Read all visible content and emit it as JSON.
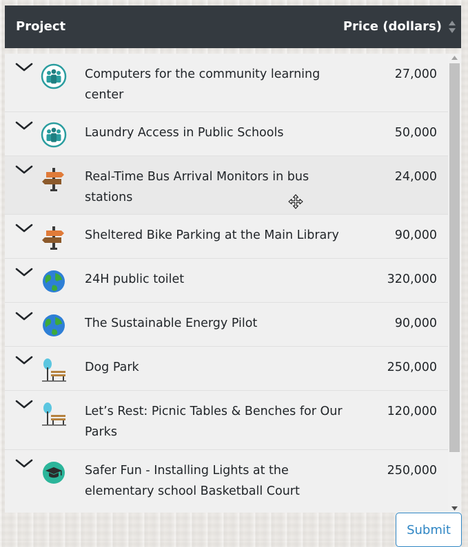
{
  "header": {
    "project_label": "Project",
    "price_label": "Price (dollars)",
    "sort_icon": "sort-icon"
  },
  "rows": [
    {
      "name": "Computers for the community learning center",
      "price": "27,000",
      "icon": "community-icon"
    },
    {
      "name": "Laundry Access in Public Schools",
      "price": "50,000",
      "icon": "community-icon"
    },
    {
      "name": "Real-Time Bus Arrival Monitors in bus stations",
      "price": "24,000",
      "icon": "signpost-icon"
    },
    {
      "name": "Sheltered Bike Parking at the Main Library",
      "price": "90,000",
      "icon": "signpost-icon"
    },
    {
      "name": "24H public toilet",
      "price": "320,000",
      "icon": "globe-icon"
    },
    {
      "name": "The Sustainable Energy Pilot",
      "price": "90,000",
      "icon": "globe-icon"
    },
    {
      "name": "Dog Park",
      "price": "250,000",
      "icon": "park-bench-icon"
    },
    {
      "name": "Let’s Rest: Picnic Tables & Benches for Our Parks",
      "price": "120,000",
      "icon": "park-bench-icon"
    },
    {
      "name": "Safer Fun - Installing Lights at the elementary school Basketball Court",
      "price": "250,000",
      "icon": "graduation-cap-icon"
    }
  ],
  "submit_label": "Submit",
  "colors": {
    "header_bg": "#343a40",
    "row_bg": "#f0f0f0",
    "accent": "#2f86c4",
    "community_icon": "#2a9d9f",
    "globe_blue": "#2e7fd6",
    "globe_green": "#3daa3a"
  }
}
